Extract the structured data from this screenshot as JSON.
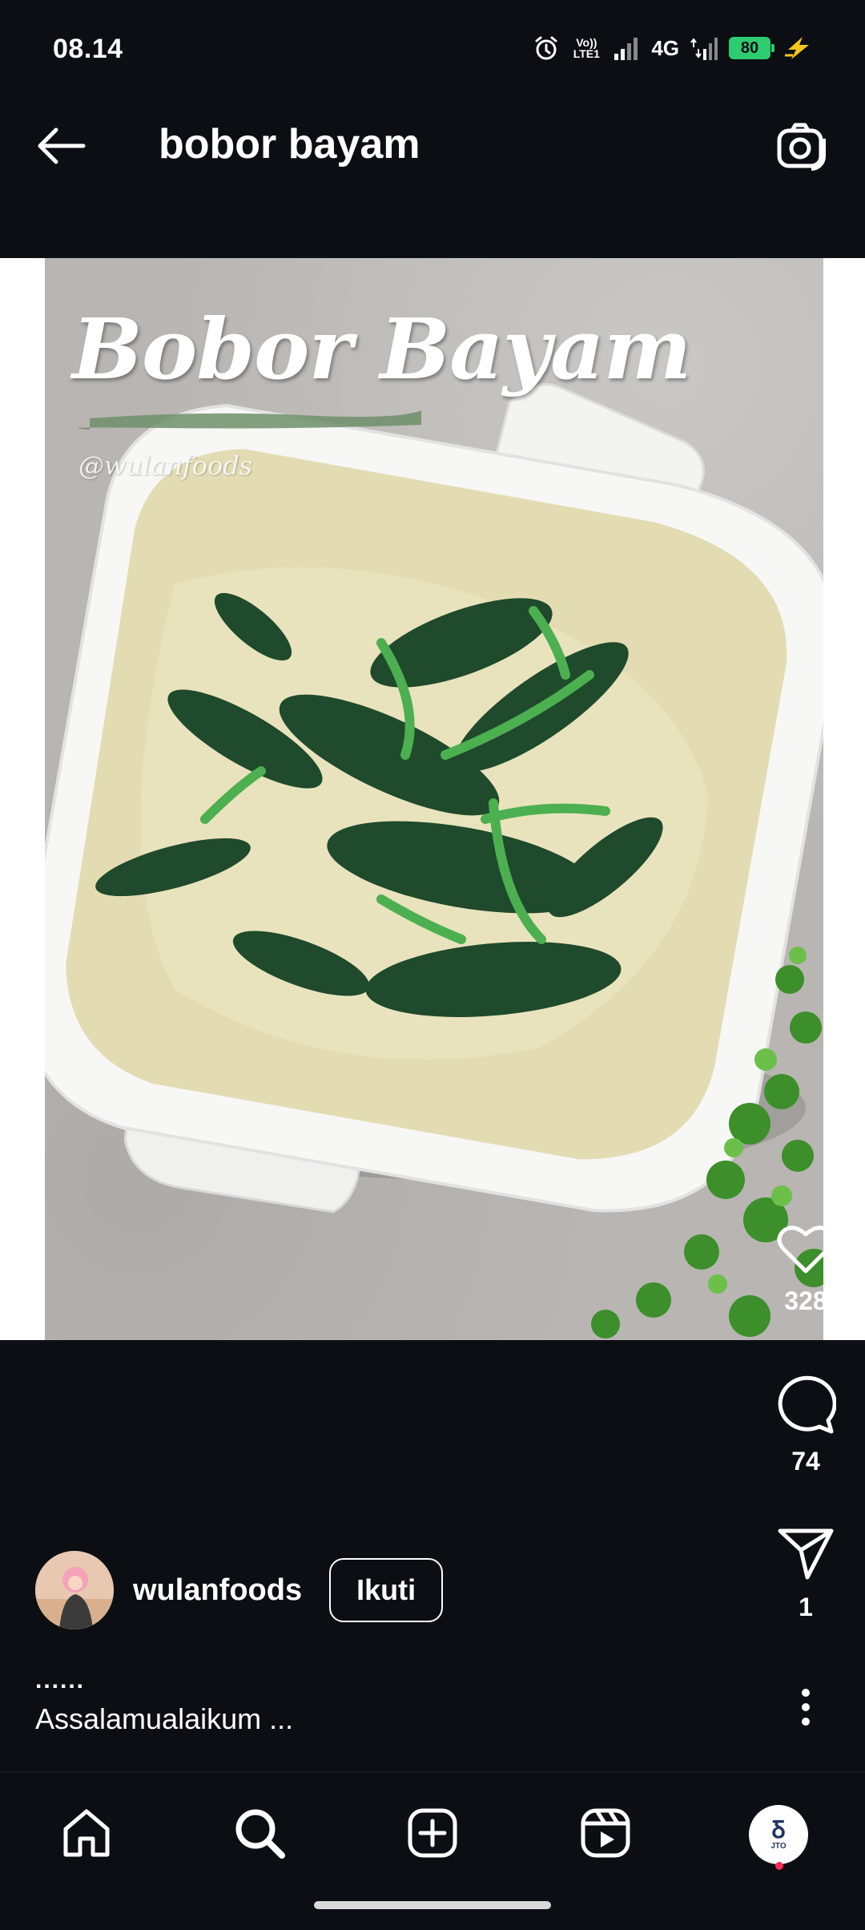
{
  "status_bar": {
    "time": "08.14",
    "network_label": "4G",
    "volte_label": "Vo)) LTE1",
    "battery_level": "80",
    "icons": [
      "alarm-icon",
      "volte-icon",
      "signal-icon",
      "signal-icon",
      "battery-icon",
      "charging-icon"
    ]
  },
  "header": {
    "title": "bobor bayam",
    "back_icon": "arrow-left-icon",
    "camera_icon": "camera-icon"
  },
  "post": {
    "image_overlay_title": "Bobor Bayam",
    "image_watermark": "@wulanfoods",
    "likes": "328",
    "comments": "74",
    "shares": "1"
  },
  "author": {
    "username": "wulanfoods",
    "follow_label": "Ikuti"
  },
  "caption": {
    "dots": "......",
    "text": "Assalamualaikum ..."
  },
  "bottom_nav": {
    "items": [
      "home-icon",
      "search-icon",
      "create-icon",
      "reels-icon",
      "profile-avatar"
    ],
    "profile_logo_mark": "Ᵹ",
    "profile_logo_text": "JTO"
  },
  "colors": {
    "background": "#0b0e13",
    "accent_battery": "#2ecc71",
    "charging": "#f5c518",
    "notification": "#ff2d55"
  }
}
